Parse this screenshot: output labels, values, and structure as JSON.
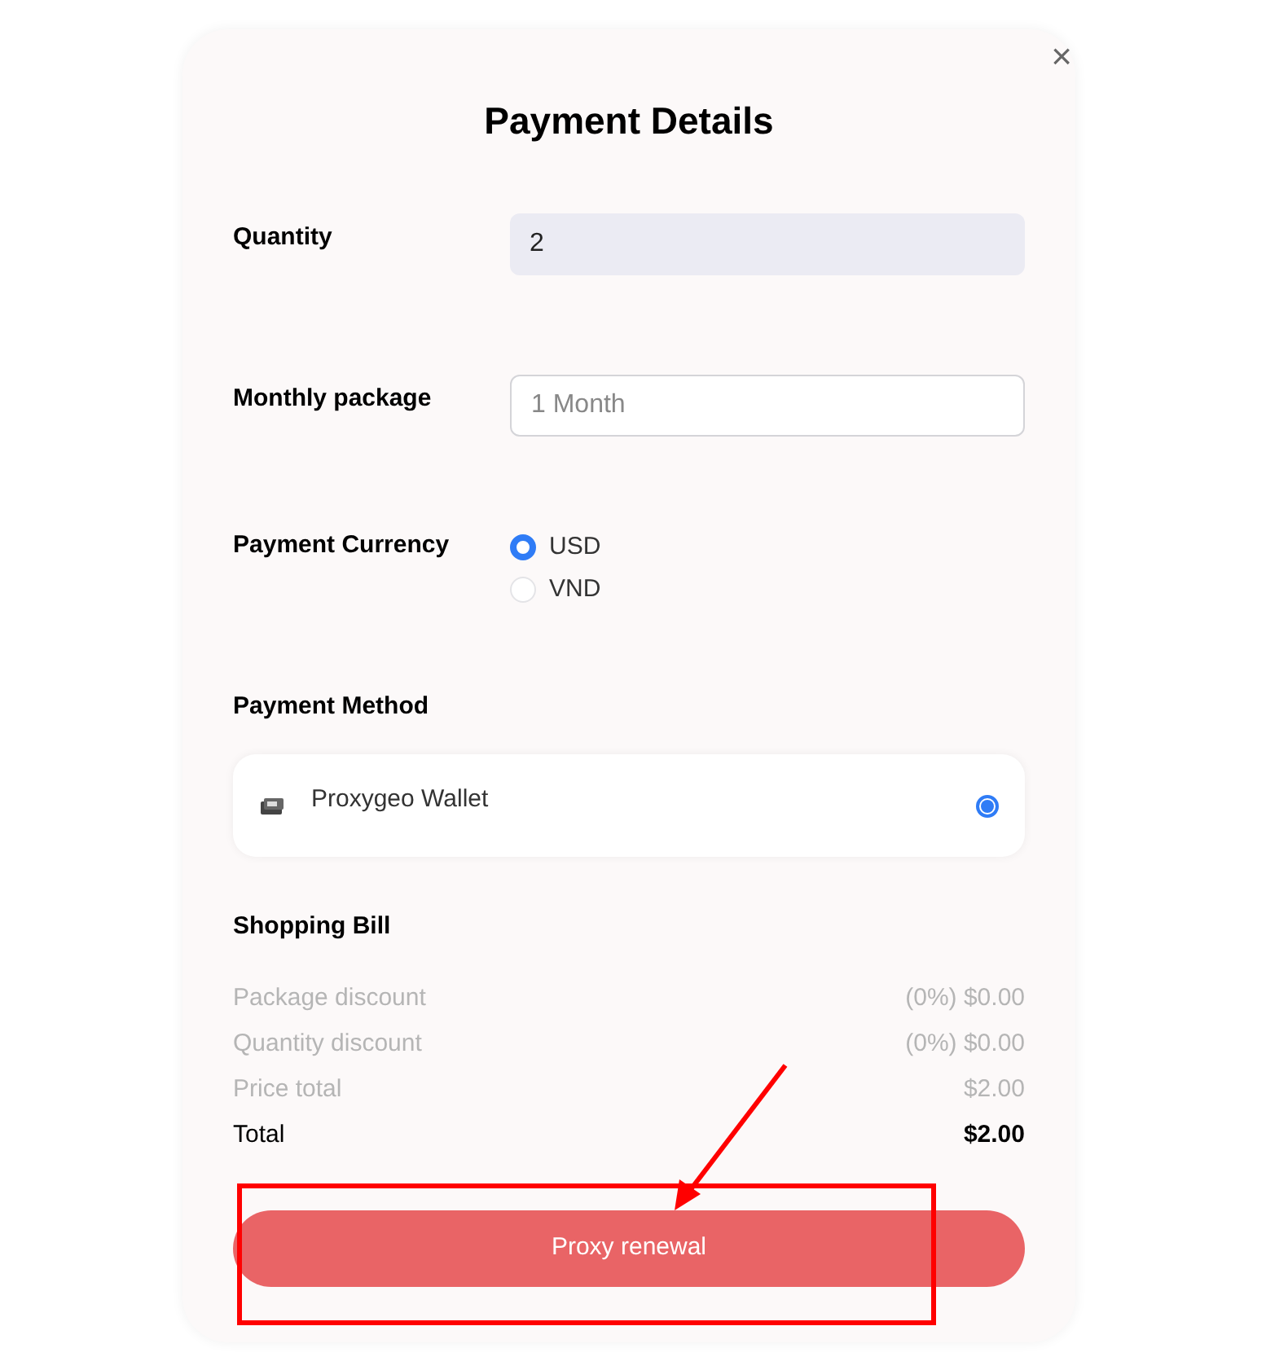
{
  "dialog": {
    "title": "Payment Details",
    "close": "×"
  },
  "fields": [
    {
      "label": "Quantity",
      "value": "2",
      "kind": "filled"
    },
    {
      "label": "Monthly package",
      "placeholder": "1 Month",
      "kind": "select"
    }
  ],
  "currency": {
    "label": "Payment Currency",
    "options": [
      {
        "label": "USD",
        "selected": true
      },
      {
        "label": "VND",
        "selected": false
      }
    ]
  },
  "payment_method": {
    "label": "Payment Method",
    "options": [
      {
        "label": "Proxygeo Wallet",
        "selected": true
      }
    ]
  },
  "bill": {
    "title": "Shopping Bill",
    "rows": [
      {
        "label": "Package discount",
        "value": "(0%) $0.00",
        "kind": "muted"
      },
      {
        "label": "Quantity discount",
        "value": "(0%) $0.00",
        "kind": "muted"
      },
      {
        "label": "Price total",
        "value": "$2.00",
        "kind": "muted"
      },
      {
        "label": "Total",
        "value": "$2.00",
        "kind": "total"
      }
    ]
  },
  "button": {
    "label": "Proxy renewal"
  }
}
